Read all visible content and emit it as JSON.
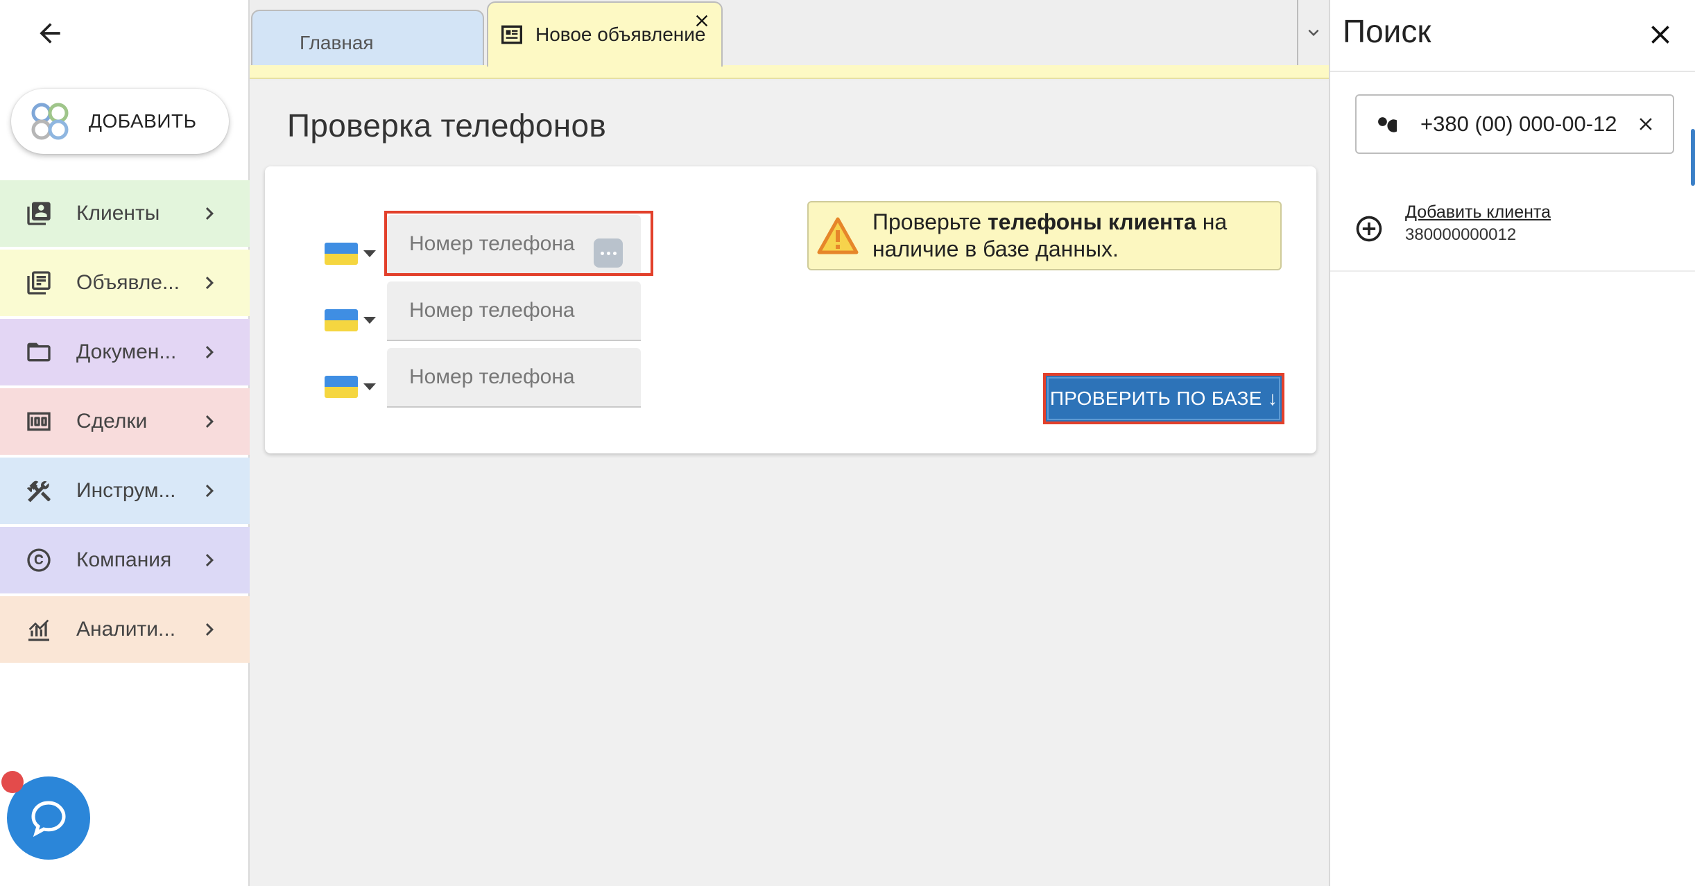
{
  "sidebar": {
    "add_label": "ДОБАВИТЬ",
    "items": [
      {
        "label": "Клиенты",
        "color": "#e3f5dc",
        "icon": "clients-icon"
      },
      {
        "label": "Объявле...",
        "color": "#fafbd2",
        "icon": "listings-icon"
      },
      {
        "label": "Докумен...",
        "color": "#e3d6f4",
        "icon": "folder-icon"
      },
      {
        "label": "Сделки",
        "color": "#f8dcdc",
        "icon": "deals-icon"
      },
      {
        "label": "Инструм...",
        "color": "#d9e8f8",
        "icon": "tools-icon"
      },
      {
        "label": "Компания",
        "color": "#dcd9f6",
        "icon": "copyright-icon"
      },
      {
        "label": "Аналити...",
        "color": "#fae6d6",
        "icon": "analytics-icon"
      }
    ]
  },
  "tabs": {
    "home_label": "Главная",
    "active_label": "Новое объявление"
  },
  "main": {
    "page_title": "Проверка телефонов",
    "phones": [
      {
        "placeholder": "Номер телефона"
      },
      {
        "placeholder": "Номер телефона"
      },
      {
        "placeholder": "Номер телефона"
      }
    ],
    "warning": {
      "prefix": "Проверьте ",
      "bold": "телефоны клиента",
      "suffix": " на наличие в базе данных."
    },
    "check_button": "ПРОВЕРИТЬ ПО БАЗЕ ↓"
  },
  "search_panel": {
    "title": "Поиск",
    "query": "+380 (00) 000-00-12",
    "result_link": "Добавить клиента",
    "result_number": "380000000012"
  },
  "colors": {
    "accent_button": "#2d73b8",
    "highlight": "#e2402b",
    "warning_bg": "#fcf7c0",
    "chat": "#2b86d9"
  }
}
